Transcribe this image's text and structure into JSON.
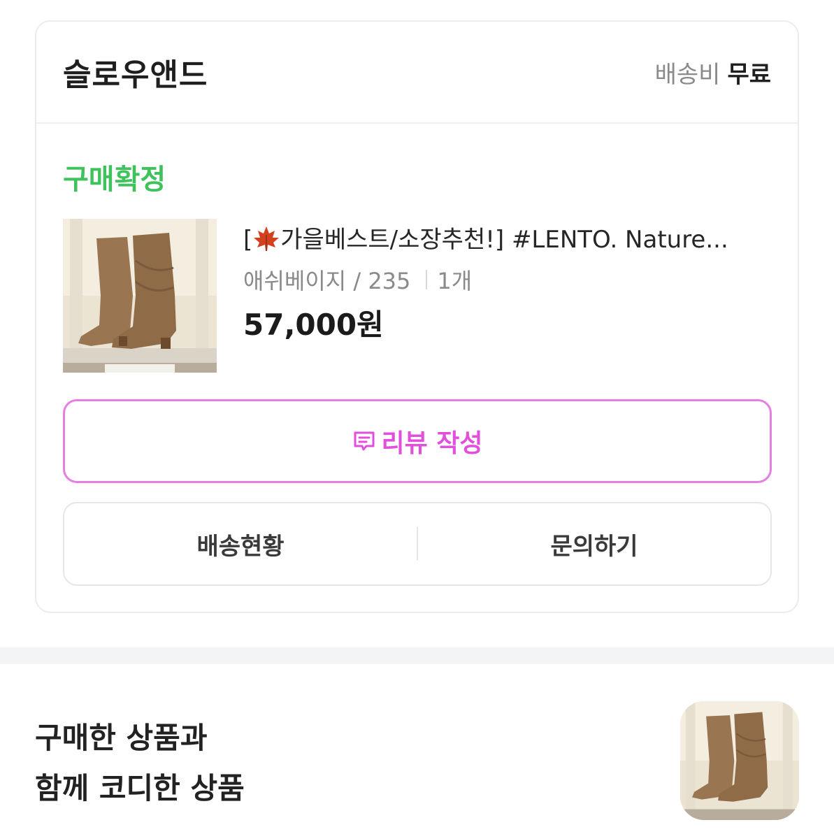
{
  "order": {
    "shop_name": "슬로우앤드",
    "shipping_label": "배송비",
    "shipping_value": "무료",
    "status": "구매확정",
    "product": {
      "title_prefix": "[",
      "title_rest": "가을베스트/소장추천!] #LENTO. Nature...",
      "option": "애쉬베이지 / 235",
      "quantity": "1개",
      "price": "57,000원",
      "image_icon": "boots-photo"
    },
    "review_button": "리뷰 작성",
    "shipping_status_button": "배송현황",
    "inquiry_button": "문의하기"
  },
  "colors": {
    "status_green": "#3fc15c",
    "review_pink": "#e34fdd",
    "review_border": "#e77ee3"
  },
  "coordi": {
    "title_line1": "구매한 상품과",
    "title_line2": "함께 코디한 상품"
  }
}
